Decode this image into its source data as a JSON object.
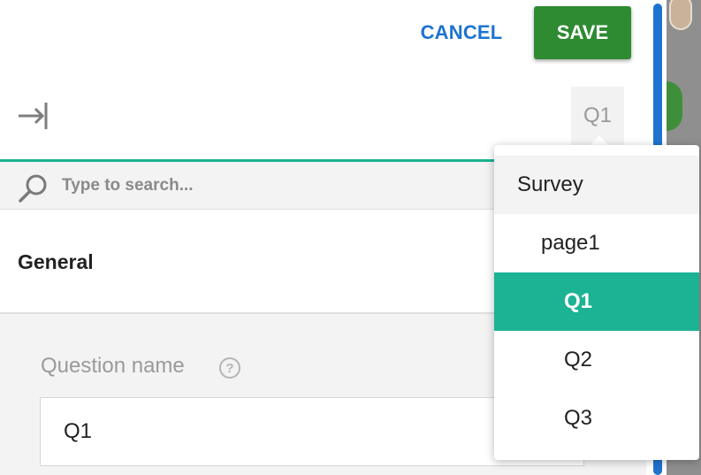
{
  "toolbar": {
    "cancel_label": "CANCEL",
    "save_label": "SAVE"
  },
  "selector": {
    "current": "Q1"
  },
  "search": {
    "placeholder": "Type to search..."
  },
  "section": {
    "title": "General"
  },
  "field": {
    "label": "Question name",
    "help": "?",
    "value": "Q1"
  },
  "dropdown": {
    "items": [
      {
        "label": "Survey",
        "state": "hover"
      },
      {
        "label": "page1"
      },
      {
        "label": "Q1",
        "state": "selected"
      },
      {
        "label": "Q2"
      },
      {
        "label": "Q3"
      }
    ]
  },
  "colors": {
    "accent": "#1bb394",
    "primary": "#1e73d0",
    "save": "#2e8b32"
  },
  "icons": [
    "collapse-panel-icon",
    "search-icon",
    "help-icon"
  ]
}
